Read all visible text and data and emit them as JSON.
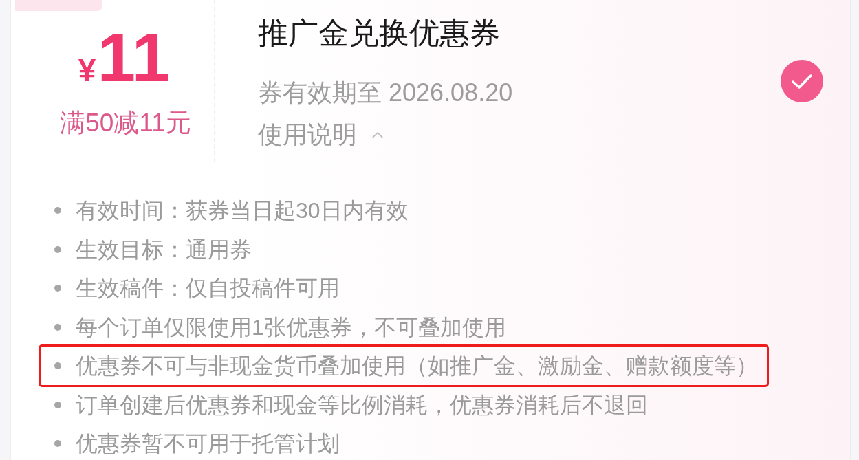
{
  "coupon": {
    "currency": "¥",
    "amount": "11",
    "condition": "满50减11元",
    "title": "推广金兑换优惠券",
    "validity": "券有效期至 2026.08.20",
    "usage_toggle": {
      "label": "使用说明",
      "expanded": true
    },
    "selected": true
  },
  "rules": [
    {
      "text": "有效时间：获券当日起30日内有效",
      "highlighted": false
    },
    {
      "text": "生效目标：通用券",
      "highlighted": false
    },
    {
      "text": "生效稿件：仅自投稿件可用",
      "highlighted": false
    },
    {
      "text": "每个订单仅限使用1张优惠券，不可叠加使用",
      "highlighted": false
    },
    {
      "text": "优惠券不可与非现金货币叠加使用（如推广金、激励金、赠款额度等）",
      "highlighted": true
    },
    {
      "text": "订单创建后优惠券和现金等比例消耗，优惠券消耗后不退回",
      "highlighted": false
    },
    {
      "text": "优惠券暂不可用于托管计划",
      "highlighted": false
    }
  ]
}
